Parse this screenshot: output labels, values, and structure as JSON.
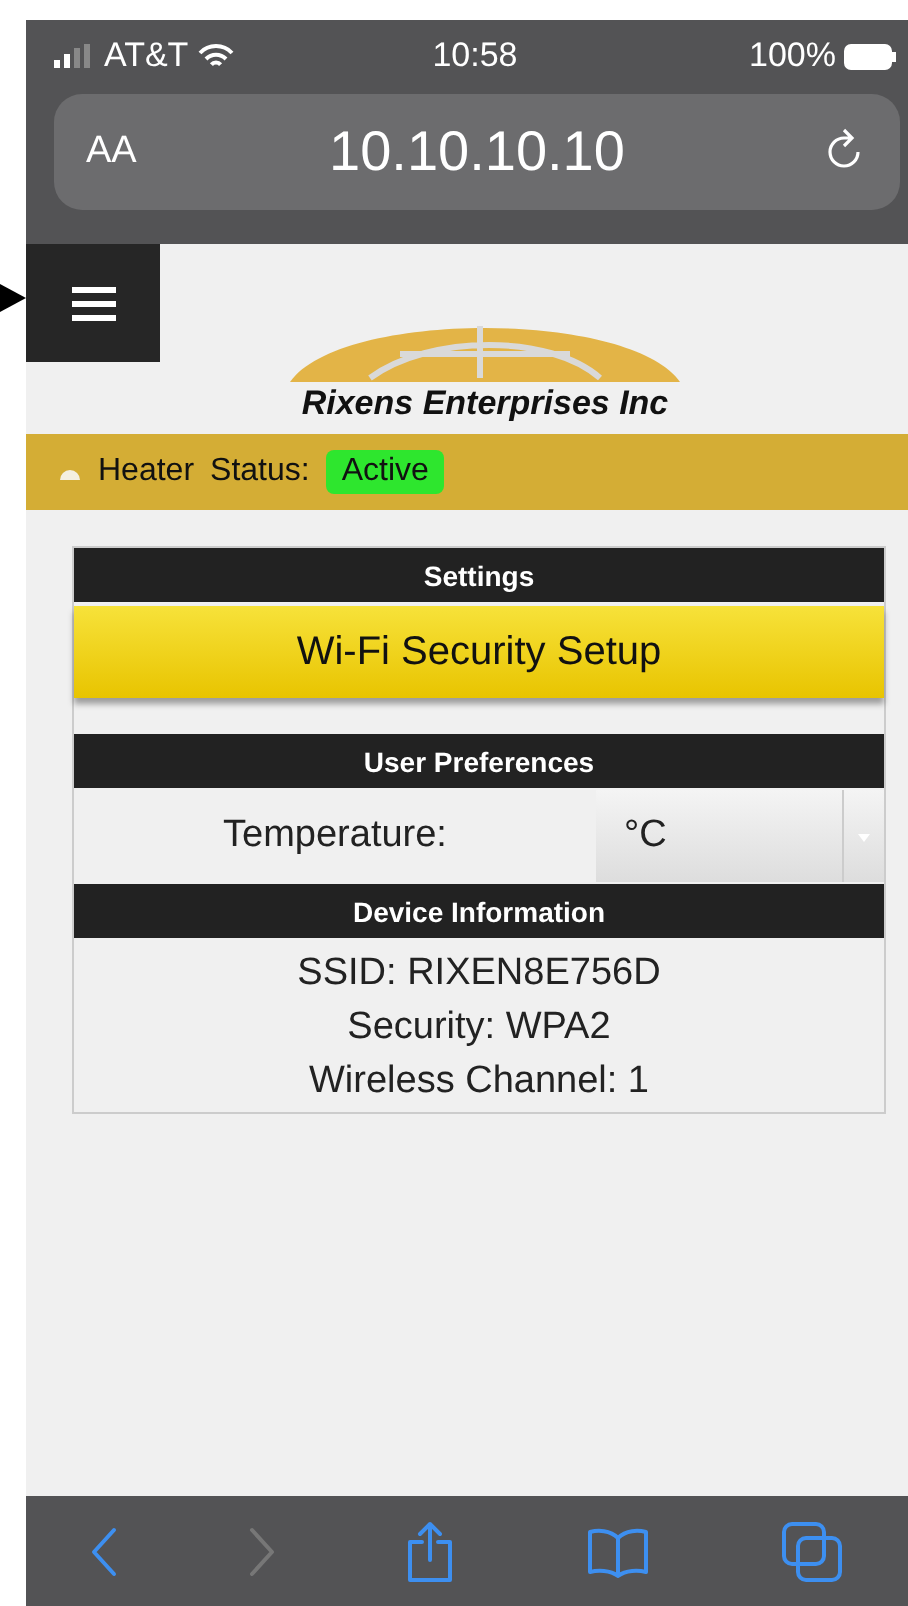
{
  "status_bar": {
    "carrier": "AT&T",
    "time": "10:58",
    "battery": "100%"
  },
  "address_bar": {
    "text_size": "AA",
    "url": "10.10.10.10"
  },
  "logo": {
    "text": "Rixens Enterprises Inc"
  },
  "status_banner": {
    "device": "Heater",
    "label": "Status:",
    "state": "Active"
  },
  "sections": [
    {
      "kind": "button",
      "title": "Settings",
      "button": "Wi-Fi Security Setup"
    },
    {
      "kind": "select",
      "title": "User Preferences",
      "label": "Temperature:",
      "value": "°C"
    },
    {
      "kind": "info",
      "title": "Device Information",
      "lines": [
        "SSID: RIXEN8E756D",
        "Security: WPA2",
        "Wireless Channel: 1"
      ]
    }
  ],
  "toolbar": [
    {
      "kind": "back",
      "disabled": false
    },
    {
      "kind": "forward",
      "disabled": true
    },
    {
      "kind": "share",
      "disabled": false
    },
    {
      "kind": "bookmarks",
      "disabled": false
    },
    {
      "kind": "tabs",
      "disabled": false
    }
  ]
}
